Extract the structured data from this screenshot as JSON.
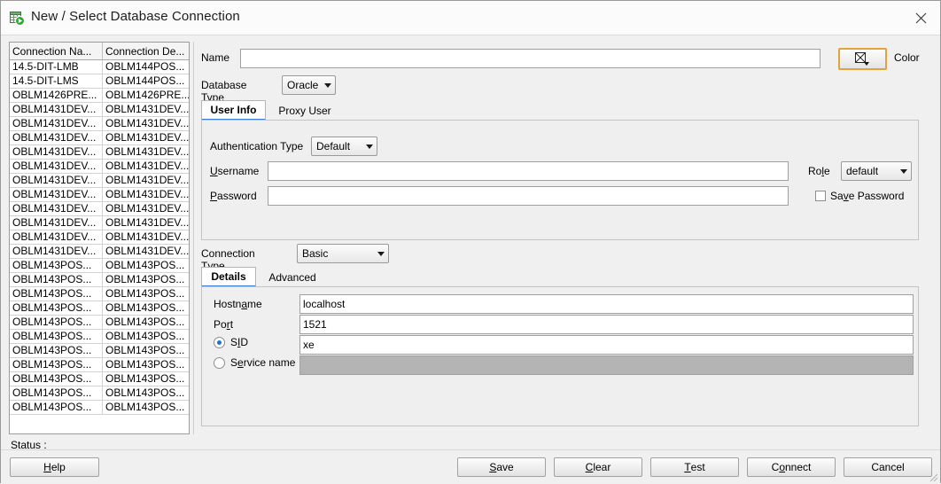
{
  "window": {
    "title": "New / Select Database Connection",
    "icon": "database-connection-icon",
    "close_icon": "close-icon"
  },
  "connection_list": {
    "columns": [
      "Connection Na...",
      "Connection De..."
    ],
    "rows": [
      [
        "14.5-DIT-LMB",
        "OBLM144POS..."
      ],
      [
        "14.5-DIT-LMS",
        "OBLM144POS..."
      ],
      [
        "OBLM1426PRE...",
        "OBLM1426PRE..."
      ],
      [
        "OBLM1431DEV...",
        "OBLM1431DEV..."
      ],
      [
        "OBLM1431DEV...",
        "OBLM1431DEV..."
      ],
      [
        "OBLM1431DEV...",
        "OBLM1431DEV..."
      ],
      [
        "OBLM1431DEV...",
        "OBLM1431DEV..."
      ],
      [
        "OBLM1431DEV...",
        "OBLM1431DEV..."
      ],
      [
        "OBLM1431DEV...",
        "OBLM1431DEV..."
      ],
      [
        "OBLM1431DEV...",
        "OBLM1431DEV..."
      ],
      [
        "OBLM1431DEV...",
        "OBLM1431DEV..."
      ],
      [
        "OBLM1431DEV...",
        "OBLM1431DEV..."
      ],
      [
        "OBLM1431DEV...",
        "OBLM1431DEV..."
      ],
      [
        "OBLM1431DEV...",
        "OBLM1431DEV..."
      ],
      [
        "OBLM143POS...",
        "OBLM143POS..."
      ],
      [
        "OBLM143POS...",
        "OBLM143POS..."
      ],
      [
        "OBLM143POS...",
        "OBLM143POS..."
      ],
      [
        "OBLM143POS...",
        "OBLM143POS..."
      ],
      [
        "OBLM143POS...",
        "OBLM143POS..."
      ],
      [
        "OBLM143POS...",
        "OBLM143POS..."
      ],
      [
        "OBLM143POS...",
        "OBLM143POS..."
      ],
      [
        "OBLM143POS...",
        "OBLM143POS..."
      ],
      [
        "OBLM143POS...",
        "OBLM143POS..."
      ],
      [
        "OBLM143POS...",
        "OBLM143POS..."
      ],
      [
        "OBLM143POS...",
        "OBLM143POS..."
      ]
    ]
  },
  "status": {
    "label": "Status :"
  },
  "form": {
    "name_label": "Name",
    "name_value": "",
    "color_button_label": "Color",
    "color_icon": "no-color-swatch-icon",
    "color_accent": "#e0a43a",
    "dbtype_label": "Database Type",
    "dbtype_value": "Oracle"
  },
  "user_tabs": {
    "items": [
      {
        "label": "User Info",
        "selected": true
      },
      {
        "label": "Proxy User",
        "selected": false
      }
    ],
    "selected_accent": "#3a7fd5"
  },
  "user_info": {
    "auth_label": "Authentication Type",
    "auth_value": "Default",
    "username_label": "Username",
    "username_value": "",
    "password_label": "Password",
    "password_value": "",
    "role_label": "Role",
    "role_value": "default",
    "save_password_label": "Save Password",
    "save_password_checked": false
  },
  "connection_type": {
    "label": "Connection Type",
    "value": "Basic"
  },
  "detail_tabs": {
    "items": [
      {
        "label": "Details",
        "selected": true
      },
      {
        "label": "Advanced",
        "selected": false
      }
    ]
  },
  "details": {
    "hostname_label": "Hostname",
    "hostname_value": "localhost",
    "port_label": "Port",
    "port_value": "1521",
    "sid_label": "SID",
    "sid_value": "xe",
    "sid_selected": true,
    "service_label": "Service name",
    "service_value": "",
    "service_selected": false,
    "service_disabled": true
  },
  "buttons": {
    "help": "Help",
    "save": "Save",
    "clear": "Clear",
    "test": "Test",
    "connect": "Connect",
    "cancel": "Cancel"
  }
}
